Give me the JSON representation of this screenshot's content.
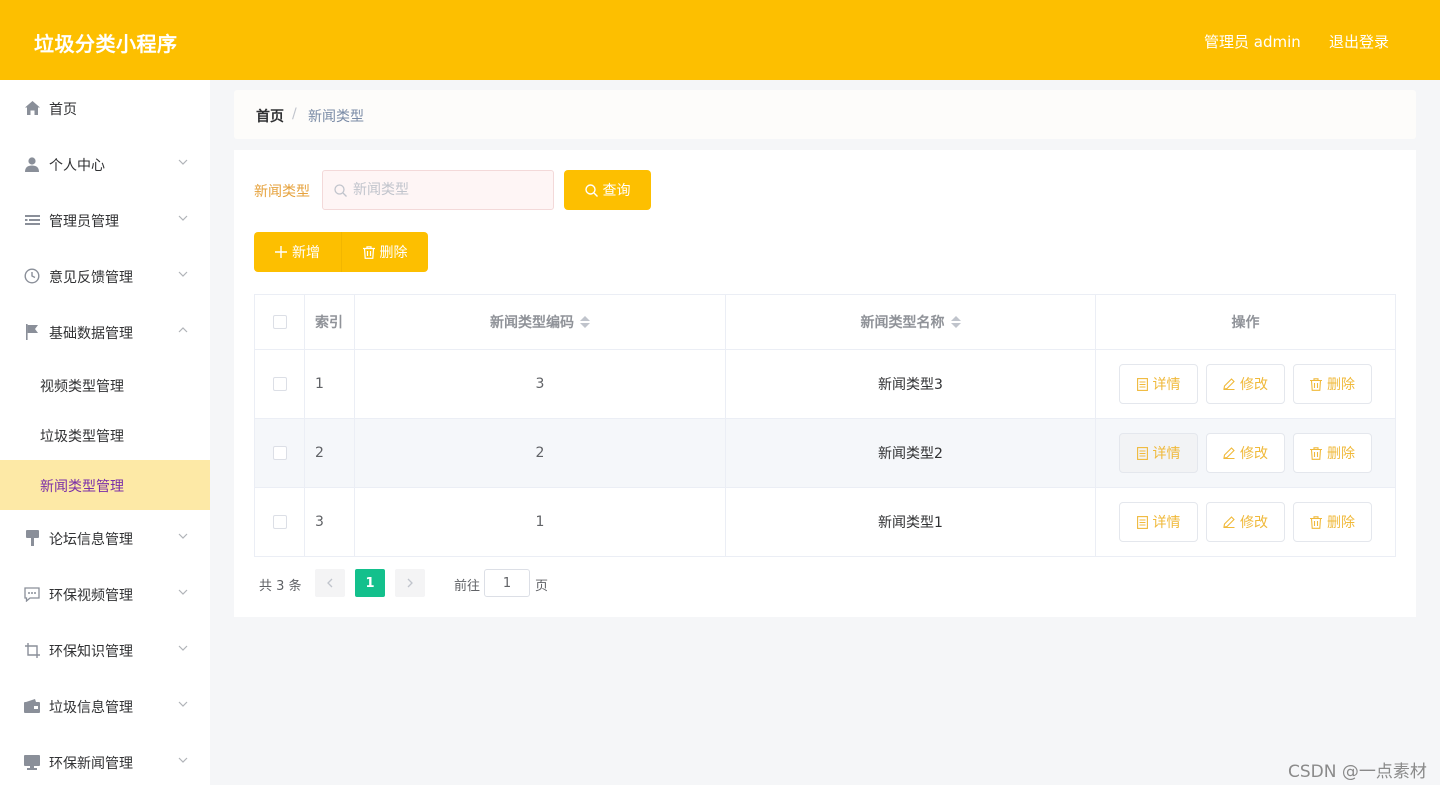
{
  "header": {
    "title": "垃圾分类小程序",
    "admin_label": "管理员 admin",
    "logout_label": "退出登录"
  },
  "sidebar": {
    "items": [
      {
        "label": "首页",
        "icon": "home-icon"
      },
      {
        "label": "个人中心",
        "icon": "user-icon"
      },
      {
        "label": "管理员管理",
        "icon": "list-icon"
      },
      {
        "label": "意见反馈管理",
        "icon": "clock-icon"
      },
      {
        "label": "基础数据管理",
        "icon": "flag-icon",
        "expanded": true,
        "children": [
          "视频类型管理",
          "垃圾类型管理",
          "新闻类型管理"
        ],
        "active_child": 2
      },
      {
        "label": "论坛信息管理",
        "icon": "brush-icon"
      },
      {
        "label": "环保视频管理",
        "icon": "chat-icon"
      },
      {
        "label": "环保知识管理",
        "icon": "crop-icon"
      },
      {
        "label": "垃圾信息管理",
        "icon": "wallet-icon"
      },
      {
        "label": "环保新闻管理",
        "icon": "monitor-icon"
      }
    ]
  },
  "breadcrumb": {
    "home": "首页",
    "separator": "/",
    "current": "新闻类型"
  },
  "search": {
    "label": "新闻类型",
    "placeholder": "新闻类型",
    "value": "",
    "button_label": "查询"
  },
  "actions": {
    "add_label": "新增",
    "delete_label": "删除"
  },
  "table": {
    "columns": {
      "index": "索引",
      "code": "新闻类型编码",
      "name": "新闻类型名称",
      "ops": "操作"
    },
    "rows": [
      {
        "index": "1",
        "code": "3",
        "name": "新闻类型3"
      },
      {
        "index": "2",
        "code": "2",
        "name": "新闻类型2"
      },
      {
        "index": "3",
        "code": "1",
        "name": "新闻类型1"
      }
    ],
    "row_actions": {
      "detail": "详情",
      "edit": "修改",
      "delete": "删除"
    }
  },
  "pagination": {
    "total_text": "共 3 条",
    "current_page": "1",
    "goto_label": "前往",
    "goto_value": "1",
    "page_unit": "页"
  },
  "watermark": "CSDN @一点素材",
  "colors": {
    "brand": "#fdbf00",
    "active_page": "#13c08c",
    "active_menu_bg": "#fde9a6",
    "active_menu_text": "#7a2ea8"
  }
}
